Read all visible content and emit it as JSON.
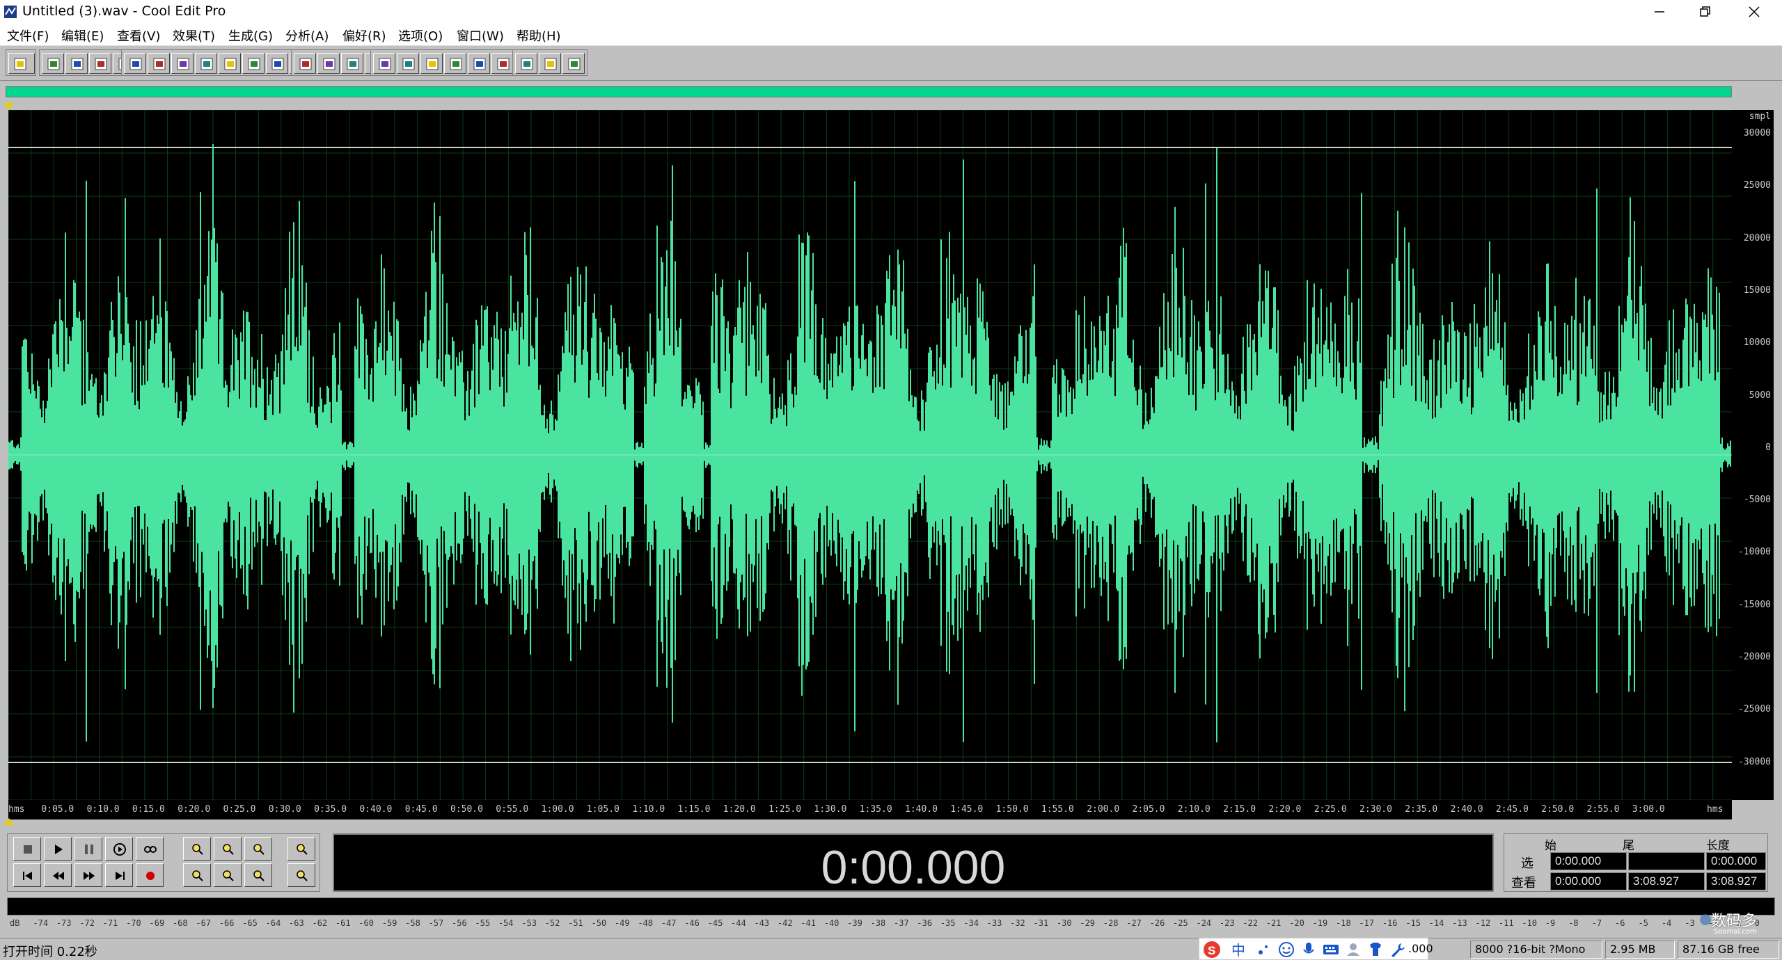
{
  "window": {
    "title": "Untitled (3).wav - Cool Edit Pro"
  },
  "menu": [
    "文件(F)",
    "编辑(E)",
    "查看(V)",
    "效果(T)",
    "生成(G)",
    "分析(A)",
    "偏好(R)",
    "选项(O)",
    "窗口(W)",
    "帮助(H)"
  ],
  "toolbar": {
    "groups": [
      {
        "icons": [
          "cd-deck-icon"
        ]
      },
      {
        "icons": [
          "new-file-icon",
          "open-file-icon",
          "save-icon",
          "save-all-icon",
          "close-file-icon"
        ]
      },
      {
        "icons": [
          "undo-icon",
          "redo-icon",
          "cut-icon",
          "copy-icon",
          "paste-icon",
          "trim-icon",
          "delete-icon",
          "mix-paste-icon",
          "convert-icon",
          "mix-icon",
          "repeat-icon"
        ]
      },
      {
        "icons": [
          "graph-icon",
          "zero-cross-icon",
          "snap-icon",
          "analysis-icon",
          "spectral-icon"
        ]
      },
      {
        "icons": [
          "frequency-icon",
          "envelope-icon",
          "noise-icon",
          "play-icon",
          "find-icon",
          "time-icon",
          "counter-icon",
          "meter-icon",
          "level-icon"
        ]
      },
      {
        "icons": [
          "cue-icon",
          "script-icon",
          "help-icon"
        ]
      }
    ]
  },
  "waveform": {
    "color": "#4ae3a0",
    "background": "#000000",
    "grid_color": "#0d3d16",
    "sample_unit": "smpl",
    "y_ticks": [
      "30000",
      "25000",
      "20000",
      "15000",
      "10000",
      "5000",
      "0",
      "-5000",
      "-10000",
      "-15000",
      "-20000",
      "-25000",
      "-30000"
    ],
    "x_unit": "hms",
    "x_ticks": [
      "hms",
      "0:05.0",
      "0:10.0",
      "0:15.0",
      "0:20.0",
      "0:25.0",
      "0:30.0",
      "0:35.0",
      "0:40.0",
      "0:45.0",
      "0:50.0",
      "0:55.0",
      "1:00.0",
      "1:05.0",
      "1:10.0",
      "1:15.0",
      "1:20.0",
      "1:25.0",
      "1:30.0",
      "1:35.0",
      "1:40.0",
      "1:45.0",
      "1:50.0",
      "1:55.0",
      "2:00.0",
      "2:05.0",
      "2:10.0",
      "2:15.0",
      "2:20.0",
      "2:25.0",
      "2:30.0",
      "2:35.0",
      "2:40.0",
      "2:45.0",
      "2:50.0",
      "2:55.0",
      "3:00.0",
      "hms"
    ]
  },
  "transport": {
    "buttons_top": [
      "stop-icon",
      "play-icon",
      "pause-icon",
      "play-to-end-icon",
      "loop-icon"
    ],
    "buttons_bottom": [
      "go-to-start-icon",
      "rewind-icon",
      "fast-forward-icon",
      "go-to-end-icon",
      "record-icon"
    ],
    "zoom": [
      "zoom-in-h-icon",
      "zoom-out-h-icon",
      "zoom-full-icon",
      "zoom-in-v-icon",
      "zoom-left-icon",
      "zoom-right-icon",
      "zoom-sel-icon",
      "zoom-out-v-icon"
    ]
  },
  "time": {
    "display": "0:00.000"
  },
  "selection": {
    "col_begin": "始",
    "col_end": "尾",
    "col_length": "长度",
    "row_sel": "选",
    "row_view": "查看",
    "sel_begin": "0:00.000",
    "sel_end": "",
    "sel_length": "0:00.000",
    "view_begin": "0:00.000",
    "view_end": "3:08.927",
    "view_length": "3:08.927"
  },
  "levels": [
    "dB",
    "-74",
    "-73",
    "-72",
    "-71",
    "-70",
    "-69",
    "-68",
    "-67",
    "-66",
    "-65",
    "-64",
    "-63",
    "-62",
    "-61",
    "-60",
    "-59",
    "-58",
    "-57",
    "-56",
    "-55",
    "-54",
    "-53",
    "-52",
    "-51",
    "-50",
    "-49",
    "-48",
    "-47",
    "-46",
    "-45",
    "-44",
    "-43",
    "-42",
    "-41",
    "-40",
    "-39",
    "-38",
    "-37",
    "-36",
    "-35",
    "-34",
    "-33",
    "-32",
    "-31",
    "-30",
    "-29",
    "-28",
    "-27",
    "-26",
    "-25",
    "-24",
    "-23",
    "-22",
    "-21",
    "-20",
    "-19",
    "-18",
    "-17",
    "-16",
    "-15",
    "-14",
    "-13",
    "-12",
    "-11",
    "-10",
    "-9",
    "-8",
    "-7",
    "-6",
    "-5",
    "-4",
    "-3",
    "-2",
    "-1",
    "0"
  ],
  "status": {
    "text": "打开时间  0.22秒",
    "zoom_value": ".000",
    "format": "8000 ?16-bit ?Mono",
    "size": "2.95 MB",
    "free": "87.16 GB free"
  },
  "ime": {
    "lang": "中"
  },
  "watermark": {
    "text": "数码多",
    "sub": "Soomal.com"
  }
}
